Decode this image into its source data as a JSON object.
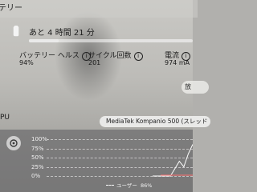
{
  "title": "テリー",
  "battery": {
    "remaining": "あと 4 時間 21 分",
    "level": 0.18
  },
  "stats": [
    {
      "label": "バッテリー ヘルス",
      "value": "94%"
    },
    {
      "label": "サイクル回数",
      "value": "201"
    },
    {
      "label": "電流",
      "value": "974 mA"
    }
  ],
  "detail_button": "放",
  "cpu": {
    "label": "PU",
    "model": "MediaTek Kompanio 500 (スレッド",
    "chart_data": {
      "type": "line",
      "yticks": [
        "100%",
        "75%",
        "50%",
        "25%",
        "0%"
      ],
      "ylim": [
        0,
        100
      ],
      "series": [
        {
          "name": "ユーザー",
          "legend_value": "86%",
          "values": [
            0,
            0,
            0,
            0,
            0,
            20,
            40,
            25,
            60,
            86
          ]
        }
      ]
    }
  },
  "colors": {
    "chart_bg": "#5a5a5c",
    "line": "#ffffff",
    "accent_line": "#e57373"
  }
}
